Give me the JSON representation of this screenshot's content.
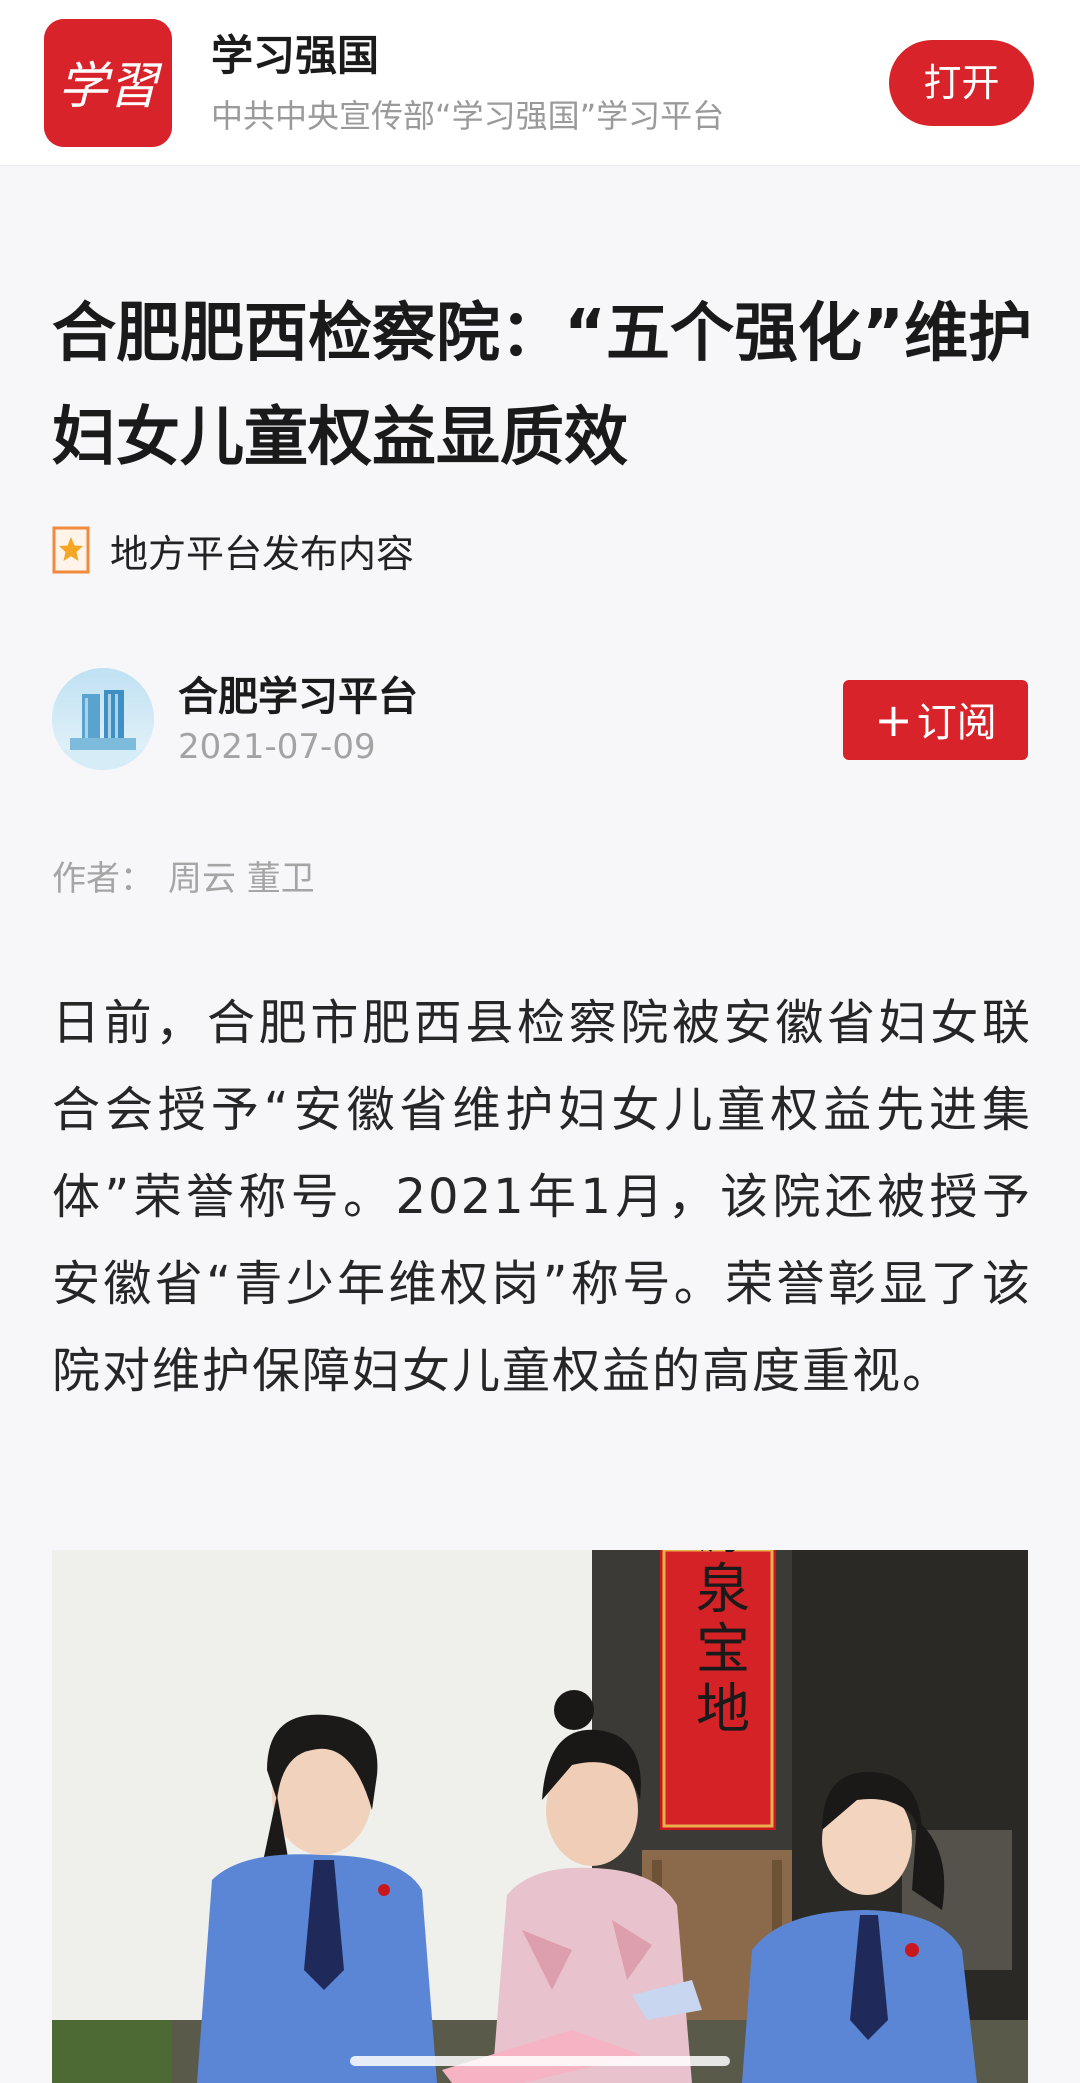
{
  "app_banner": {
    "logo_text": "学習",
    "app_name": "学习强国",
    "subtitle": "中共中央宣传部“学习强国”学习平台",
    "open_label": "打开"
  },
  "article": {
    "title": "合肥肥西检察院：“五个强化”维护妇女儿童权益显质效",
    "source_tag": "地方平台发布内容",
    "publisher": {
      "name": "合肥学习平台",
      "date": "2021-07-09",
      "subscribe_label": "订阅"
    },
    "author_label": "作者：",
    "author_names": "周云 董卫",
    "paragraphs": [
      "日前，合肥市肥西县检察院被安徽省妇女联合会授予“安徽省维护妇女儿童权益先进集体”荣誉称号。2021年1月，该院还被授予安徽省“青少年维权岗”称号。荣誉彰显了该院对维护保障妇女儿童权益的高度重视。"
    ],
    "photo": {
      "banner_text": "源泉宝地"
    }
  },
  "colors": {
    "accent": "#d9232a",
    "background": "#f7f7f9",
    "muted_text": "#9a9a9a"
  },
  "icons": {
    "source_tag": "star-bookmark-icon",
    "subscribe": "plus-icon"
  }
}
